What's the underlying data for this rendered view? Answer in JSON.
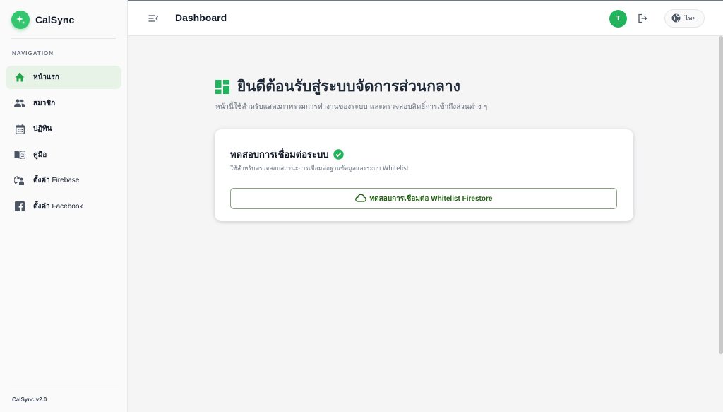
{
  "app": {
    "name": "CalSync",
    "version": "CalSync v2.0",
    "accent": "#34c56f"
  },
  "sidebar": {
    "heading": "NAVIGATION",
    "items": [
      {
        "icon": "home-icon",
        "label": "หน้าแรก",
        "extra": "",
        "active": true
      },
      {
        "icon": "members-icon",
        "label": "สมาชิก",
        "extra": "",
        "active": false
      },
      {
        "icon": "calendar-icon",
        "label": "ปฏิทิน",
        "extra": "",
        "active": false
      },
      {
        "icon": "book-icon",
        "label": "คู่มือ",
        "extra": "",
        "active": false
      },
      {
        "icon": "firebase-settings-icon",
        "label": "ตั้งค่า",
        "extra": " Firebase",
        "active": false
      },
      {
        "icon": "facebook-icon",
        "label": "ตั้งค่า",
        "extra": " Facebook",
        "active": false
      }
    ]
  },
  "header": {
    "title": "Dashboard",
    "avatar_initial": "T",
    "language_label": "ไทย"
  },
  "main": {
    "welcome_title": "ยินดีต้อนรับสู่ระบบจัดการส่วนกลาง",
    "welcome_subtitle": "หน้านี้ใช้สำหรับแสดงภาพรวมการทำงานของระบบ และตรวจสอบสิทธิ์การเข้าถึงส่วนต่าง ๆ",
    "card": {
      "title": "ทดสอบการเชื่อมต่อระบบ",
      "description": "ใช้สำหรับตรวจสอบสถานะการเชื่อมต่อฐานข้อมูลและระบบ Whitelist",
      "button_label": "ทดสอบการเชื่อมต่อ Whitelist Firestore"
    }
  }
}
